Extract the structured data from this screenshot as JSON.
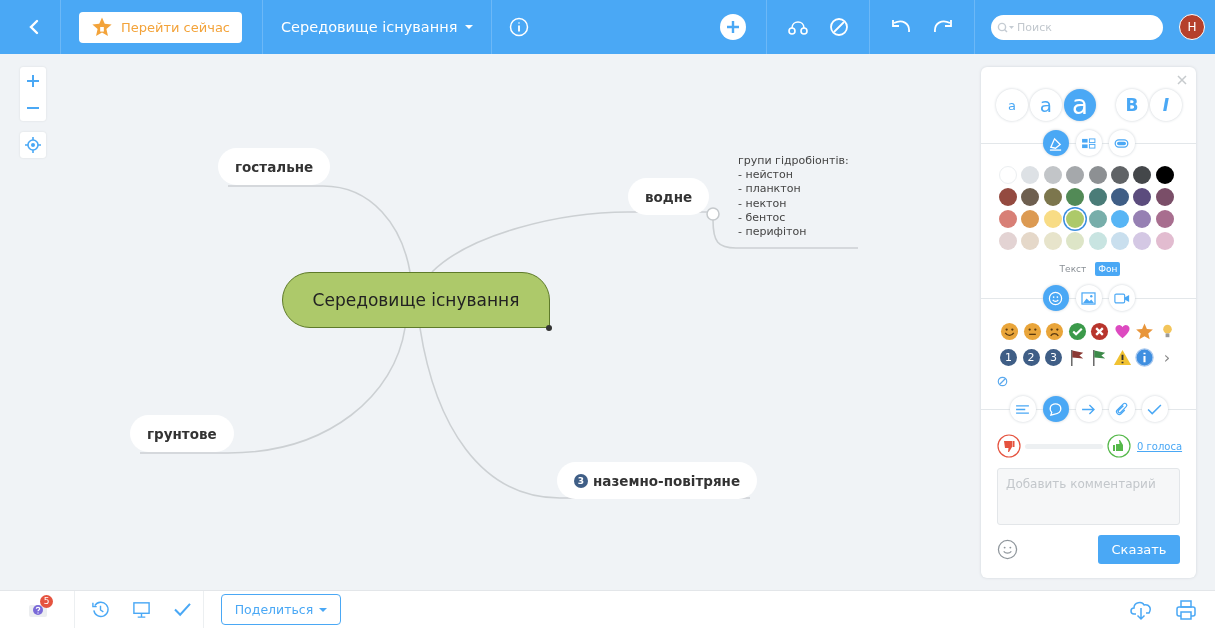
{
  "toolbar": {
    "go_now": "Перейти сейчас",
    "map_title": "Середовище існування",
    "search": {
      "placeholder": "Поиск"
    },
    "avatar": "Н"
  },
  "map": {
    "central": "Середовище існування",
    "branches": [
      {
        "label": "гостальне"
      },
      {
        "label": "водне",
        "note": [
          "групи гідробіонтів:",
          "- нейстон",
          "- планктон",
          "- нектон",
          "- бентос",
          "- перифітон"
        ]
      },
      {
        "label": "грунтове"
      },
      {
        "label": "наземно-повітряне",
        "badge": "3"
      }
    ]
  },
  "panel": {
    "font_sizes": [
      {
        "label": "a",
        "selected": false
      },
      {
        "label": "a",
        "selected": false
      },
      {
        "label": "a",
        "selected": true
      }
    ],
    "font_styles": [
      {
        "label": "B",
        "kind": "bold"
      },
      {
        "label": "I",
        "kind": "italic"
      }
    ],
    "style_tabs": [
      {
        "kind": "fill",
        "selected": true
      },
      {
        "kind": "layout",
        "selected": false
      },
      {
        "kind": "shape",
        "selected": false
      }
    ],
    "swatches": [
      {
        "color": "#ffffff",
        "selected": false
      },
      {
        "color": "#dde1e5",
        "selected": false
      },
      {
        "color": "#c2c5c8",
        "selected": false
      },
      {
        "color": "#a5a8ab",
        "selected": false
      },
      {
        "color": "#8d9093",
        "selected": false
      },
      {
        "color": "#606366",
        "selected": false
      },
      {
        "color": "#44474a",
        "selected": false
      },
      {
        "color": "#000000",
        "selected": false
      },
      {
        "color": "#944a40",
        "selected": false
      },
      {
        "color": "#6e5f4f",
        "selected": false
      },
      {
        "color": "#7c764d",
        "selected": false
      },
      {
        "color": "#528a56",
        "selected": false
      },
      {
        "color": "#4a7c78",
        "selected": false
      },
      {
        "color": "#3f5e86",
        "selected": false
      },
      {
        "color": "#5b4c7d",
        "selected": false
      },
      {
        "color": "#7a4e68",
        "selected": false
      },
      {
        "color": "#d87f76",
        "selected": false
      },
      {
        "color": "#dc9a52",
        "selected": false
      },
      {
        "color": "#f8dc85",
        "selected": false
      },
      {
        "color": "#adc96a",
        "selected": true
      },
      {
        "color": "#77aeaa",
        "selected": false
      },
      {
        "color": "#57b5f5",
        "selected": false
      },
      {
        "color": "#9680b3",
        "selected": false
      },
      {
        "color": "#a86e8f",
        "selected": false
      },
      {
        "color": "#e3d3d3",
        "selected": false
      },
      {
        "color": "#e5d8c9",
        "selected": false
      },
      {
        "color": "#e7e4cb",
        "selected": false
      },
      {
        "color": "#dde5c7",
        "selected": false
      },
      {
        "color": "#c8e4e1",
        "selected": false
      },
      {
        "color": "#c9dfee",
        "selected": false
      },
      {
        "color": "#d4c8e4",
        "selected": false
      },
      {
        "color": "#e2bcd0",
        "selected": false
      }
    ],
    "color_targets": [
      {
        "label": "Текст",
        "selected": false
      },
      {
        "label": "Фон",
        "selected": true
      }
    ],
    "media_tabs": [
      {
        "kind": "emoji",
        "selected": true
      },
      {
        "kind": "image",
        "selected": false
      },
      {
        "kind": "video",
        "selected": false
      }
    ],
    "icons": [
      {
        "kind": "smile"
      },
      {
        "kind": "neutral"
      },
      {
        "kind": "sad"
      },
      {
        "kind": "check"
      },
      {
        "kind": "cross"
      },
      {
        "kind": "heart"
      },
      {
        "kind": "star"
      },
      {
        "kind": "bulb"
      },
      {
        "kind": "number",
        "label": "1"
      },
      {
        "kind": "number",
        "label": "2"
      },
      {
        "kind": "number",
        "label": "3"
      },
      {
        "kind": "flag",
        "color": "#8b3a35"
      },
      {
        "kind": "flag",
        "color": "#3d8a4a"
      },
      {
        "kind": "warning"
      },
      {
        "kind": "info"
      },
      {
        "kind": "more",
        "label": "›"
      }
    ],
    "tool_tabs": [
      {
        "kind": "notes",
        "selected": false
      },
      {
        "kind": "comments",
        "selected": true
      },
      {
        "kind": "link",
        "selected": false
      },
      {
        "kind": "attach",
        "selected": false
      },
      {
        "kind": "task",
        "selected": false
      }
    ],
    "votes": {
      "link": "0 голоса"
    },
    "comment": {
      "placeholder": "Добавить комментарий"
    },
    "submit": "Сказать"
  },
  "bottom": {
    "help_badge": "5",
    "share": "Поделиться"
  }
}
